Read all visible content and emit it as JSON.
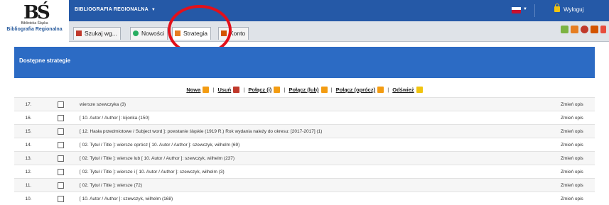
{
  "header": {
    "logo_small": "Biblioteka Śląska",
    "logo_name": "Bibliografia Regionalna",
    "app_menu": "BIBLIOGRAFIA REGIONALNA",
    "logout": "Wyloguj"
  },
  "tabs": [
    {
      "label": "Szukaj wg...",
      "icon": "search-books-icon"
    },
    {
      "label": "Nowości",
      "icon": "new-items-icon"
    },
    {
      "label": "Strategia",
      "icon": "strategy-icon"
    },
    {
      "label": "Konto",
      "icon": "account-icon"
    }
  ],
  "panel": {
    "title": "Dostępne strategie"
  },
  "actions": {
    "new": "Nowa",
    "delete": "Usuń",
    "and": "Połącz (i)",
    "or": "Połącz (lub)",
    "not": "Połącz (oprócz)",
    "refresh": "Odśwież",
    "separator": "|"
  },
  "rows": [
    {
      "num": "17.",
      "text": "wiersze szewczyka (3)",
      "edit": "Zmień opis"
    },
    {
      "num": "16.",
      "text": "[ 10. Autor / Author ]: kijonka (150)",
      "edit": "Zmień opis"
    },
    {
      "num": "15.",
      "text": "[ 12. Hasła przedmiotowe / Subject word ]: powstanie śląskie (1919 R.) Rok wydania należy do okresu: [2017-2017] (1)",
      "edit": "Zmień opis"
    },
    {
      "num": "14.",
      "text": "[ 02. Tytuł / Title ]: wiersze oprócz [ 10. Autor / Author ]: szewczyk, wilhelm (69)",
      "edit": "Zmień opis"
    },
    {
      "num": "13.",
      "text": "[ 02. Tytuł / Title ]: wiersze lub [ 10. Autor / Author ]: szewczyk, wilhelm (237)",
      "edit": "Zmień opis"
    },
    {
      "num": "12.",
      "text": "[ 02. Tytuł / Title ]: wiersze i [ 10. Autor / Author ]: szewczyk, wilhelm (3)",
      "edit": "Zmień opis"
    },
    {
      "num": "11.",
      "text": "[ 02. Tytuł / Title ]: wiersze (72)",
      "edit": "Zmień opis"
    },
    {
      "num": "10.",
      "text": "[ 10. Autor / Author ]: szewczyk, wilhelm (168)",
      "edit": "Zmień opis"
    }
  ],
  "colors": {
    "topbar": "#2559a7",
    "panel_header": "#2c6bc4",
    "highlight": "#e3101b"
  }
}
